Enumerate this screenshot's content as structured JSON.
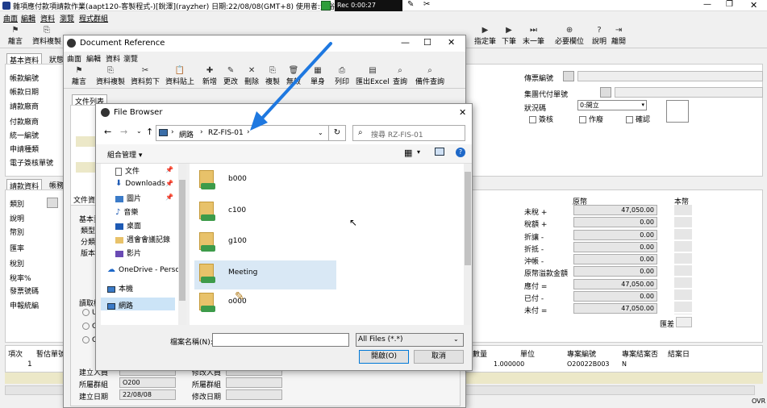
{
  "main": {
    "title": "雜項應付款項請款作業(aapt120-客製程式-)[銳澤](rayzher) 日期:22/08/08(GMT+8) 使用者:黃裕鑅",
    "rec_label": "Rec 0:00:27",
    "menu": [
      "曲面",
      "編輯",
      "資料",
      "瀏覽",
      "程式群組"
    ],
    "toolbar": [
      "離言",
      "資料複製",
      "指定筆",
      "下筆",
      "末一筆",
      "必要欄位",
      "說明",
      "離開"
    ],
    "tabs": [
      "基本資料",
      "狀態",
      "請款資料",
      "帳務"
    ],
    "left_labels": [
      "帳款編號",
      "帳款日期",
      "請款廠商",
      "付款廠商",
      "統一編號",
      "申請種類",
      "電子簽核單號"
    ],
    "left_labels2": [
      "類別",
      "說明",
      "幣別",
      "匯率",
      "稅別",
      "稅率%",
      "發票號碼",
      "申報統編"
    ],
    "right_labels": [
      "傳票編號",
      "集團代付單號",
      "狀況碼"
    ],
    "status_value": "0:開立",
    "checkboxes": [
      "簽核",
      "作廢",
      "確認"
    ],
    "amount_headers": [
      "原幣",
      "本幣"
    ],
    "amount_labels": [
      "未稅 +",
      "稅額 +",
      "折讓 -",
      "折抵 -",
      "沖帳 -",
      "原幣溢款金額",
      "應付 =",
      "已付 -",
      "未付 ="
    ],
    "amount_values": [
      "47,050.00",
      "0.00",
      "0.00",
      "0.00",
      "0.00",
      "0.00",
      "47,050.00",
      "0.00",
      "47,050.00"
    ],
    "rate_label": "匯差",
    "grid_headers_left": [
      "項次",
      "暫估單號"
    ],
    "grid_row_left": [
      "1"
    ],
    "grid_headers_right": [
      "數量",
      "單位",
      "專案編號",
      "專案結案否",
      "結案日"
    ],
    "grid_row_right": [
      "1.000000",
      "O20022B003",
      "N"
    ],
    "bottom_left": [
      {
        "label": "建立人員",
        "value": ""
      },
      {
        "label": "所屬群組",
        "value": "O200"
      },
      {
        "label": "建立日期",
        "value": "22/08/08"
      }
    ],
    "bottom_right_labels": [
      "修改人員",
      "所屬群組",
      "修改日期"
    ],
    "ovr": "OVR",
    "doc_info_label": "文件資訊",
    "info_labels": [
      "基本資",
      "類型",
      "分類",
      "版本",
      "讀取權限"
    ],
    "radio_labels": [
      "U",
      "G",
      "O"
    ]
  },
  "docref": {
    "title": "Document Reference",
    "menu": [
      "曲面",
      "編輯",
      "資料",
      "瀏覽"
    ],
    "toolbar": [
      "離言",
      "資料複製",
      "資料剪下",
      "資料貼上",
      "新增",
      "更改",
      "刪除",
      "複製",
      "無效",
      "單身",
      "列印",
      "匯出Excel",
      "查詢",
      "備件查詢"
    ],
    "list_label": "文件列表",
    "info_label": "文件資訊"
  },
  "filebrowser": {
    "title": "File Browser",
    "path": [
      "網路",
      "RZ-FIS-01"
    ],
    "search_placeholder": "搜尋 RZ-FIS-01",
    "organize": "組合管理",
    "sidebar": [
      "文件",
      "Downloads",
      "圖片",
      "音樂",
      "桌面",
      "週會會議記錄",
      "影片",
      "OneDrive - Perso",
      "本機",
      "網路"
    ],
    "folders": [
      "b000",
      "c100",
      "g100",
      "Meeting",
      "o000"
    ],
    "filename_label": "檔案名稱(N):",
    "filename_value": "",
    "filter": "All Files (*.*)",
    "open_label": "開啟(O)",
    "cancel_label": "取消"
  }
}
